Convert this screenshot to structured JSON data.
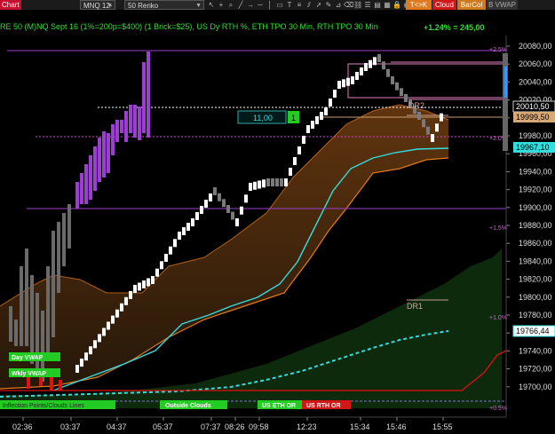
{
  "toolbar": {
    "title": "Chart",
    "symbol": "MNQ 12-24",
    "period": "50 Renko",
    "buttons": [
      "T<>K",
      "Cloud",
      "BarCol",
      "B VWAP"
    ]
  },
  "chart": {
    "header_text": "RE 50 (M)NQ Sept 16 (1%=200p=$400) (1 Brick=$25), US Dy RTH %, ETH TPO 30 Min, RTH TPO 30 Min",
    "change_text": "+1.24% = 245,00",
    "box_value": "11,00",
    "box_count": "1",
    "annotations": {
      "dr2": "DR2",
      "dr1": "DR1"
    },
    "pct_labels": [
      "+2.5%",
      "+2.0%",
      "+1.5%",
      "+1.0%",
      "+0.5%"
    ],
    "price_axis": [
      "20080,00",
      "20060,00",
      "20040,00",
      "20020,00",
      "20000,00",
      "19980,00",
      "19960,00",
      "19940,00",
      "19920,00",
      "19900,00",
      "19880,00",
      "19860,00",
      "19840,00",
      "19820,00",
      "19800,00",
      "19780,00",
      "19760,00",
      "19740,00",
      "19720,00",
      "19700,00"
    ],
    "price_tags": {
      "last": "20010,50",
      "tan": "19999,50",
      "cyan": "19967,10",
      "vwap": "19766,44"
    },
    "time_axis": [
      "02:36",
      "03:37",
      "04:37",
      "05:37",
      "07:37",
      "08:26",
      "09:58",
      "12:23",
      "15:34",
      "15:46",
      "15:55"
    ],
    "bottom_labels": {
      "day_vwap": "Day VWAP",
      "wkly_vwap": "Wkly VWAP",
      "left_text": "Inflection Points/Clouds Lines",
      "outside": "Outside Clouds",
      "eth_or": "US ETH OR",
      "rth_or": "US RTH OR"
    },
    "colors": {
      "bull": "#ffffff",
      "bear": "#7a7a7a",
      "purple": "#9b3fd0",
      "cyan": "#33dddd",
      "orange": "#e07a20",
      "red": "#e01010",
      "green": "#22cc22",
      "magenta": "#d040d0"
    }
  }
}
